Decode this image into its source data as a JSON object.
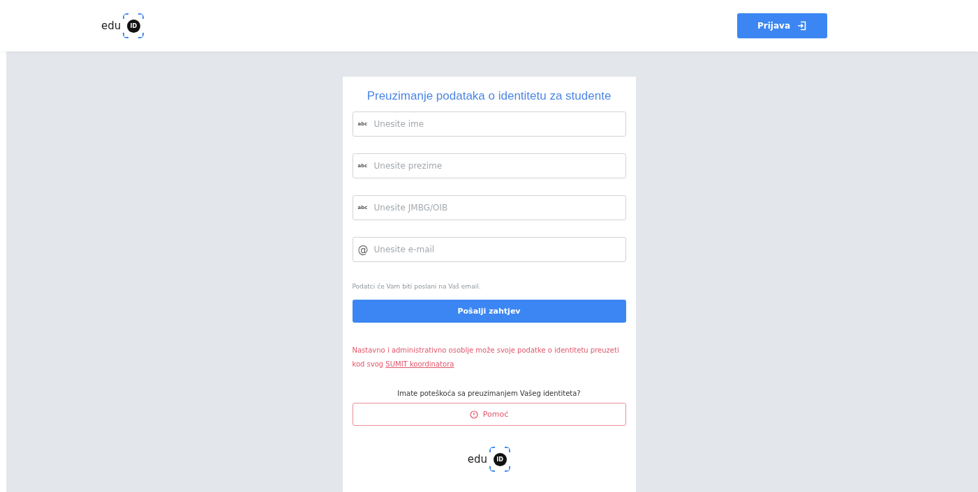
{
  "header": {
    "logo": {
      "word": "edu",
      "mark": "ID"
    },
    "login_button": {
      "label": "Prijava"
    }
  },
  "card": {
    "title": "Preuzimanje podataka o identitetu za studente",
    "fields": [
      {
        "kind": "text",
        "icon_text": "abc",
        "placeholder": "Unesite ime"
      },
      {
        "kind": "text",
        "icon_text": "abc",
        "placeholder": "Unesite prezime"
      },
      {
        "kind": "text",
        "icon_text": "abc",
        "placeholder": "Unesite JMBG/OIB"
      },
      {
        "kind": "email",
        "icon_text": "@",
        "placeholder": "Unesite e-mail"
      }
    ],
    "hint": "Podatci će Vam biti poslani na Vaš email.",
    "submit_button": "Pošalji zahtjev",
    "staff_note": {
      "text": "Nastavno i administrativno osoblje može svoje podatke o identitetu preuzeti kod svog ",
      "link": "SUMIT koordinatora"
    },
    "help_question": "Imate poteškoća sa preuzimanjem Vašeg identiteta?",
    "help_button": "Pomoć",
    "footer_logo": {
      "word": "edu",
      "mark": "ID"
    }
  }
}
